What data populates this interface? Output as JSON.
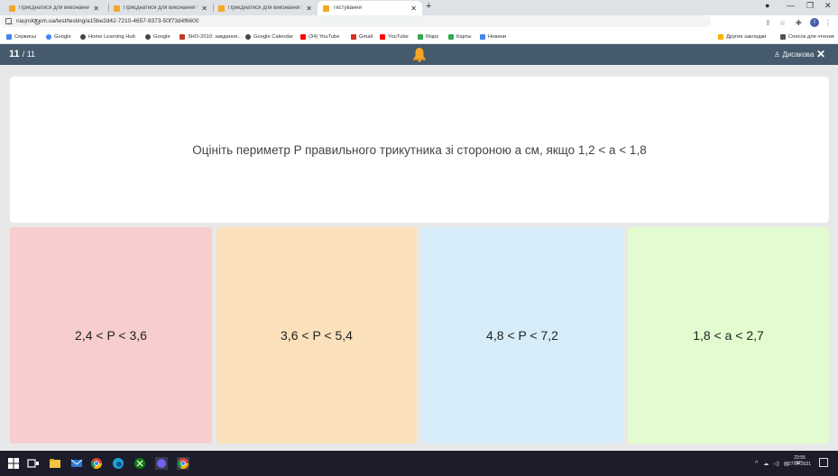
{
  "browser": {
    "tabs": [
      {
        "title": "Приєднатися для виконання те",
        "active": false
      },
      {
        "title": "Приєднатися для виконання те",
        "active": false
      },
      {
        "title": "Приєднатися для виконання те",
        "active": false
      },
      {
        "title": "Тестування",
        "active": true
      }
    ],
    "url": "naurok.com.ua/test/testing/a15be2d42-7210-4657-9373-50f73d4f6600",
    "bookmarks": [
      {
        "label": "Сервисы",
        "icon": "apps-grid-icon",
        "color": "#4285f4"
      },
      {
        "label": "Google",
        "icon": "google-icon",
        "color": "#4285f4"
      },
      {
        "label": "Home Learning Hub",
        "icon": "globe-icon",
        "color": "#444444"
      },
      {
        "label": "Google",
        "icon": "globe-icon",
        "color": "#444444"
      },
      {
        "label": "ЗНО-2010: завдання...",
        "icon": "zno-icon",
        "color": "#c0392b"
      },
      {
        "label": "Google Calendar",
        "icon": "globe-icon",
        "color": "#444444"
      },
      {
        "label": "(34) YouTube",
        "icon": "youtube-icon",
        "color": "#ff0000"
      },
      {
        "label": "Gmail",
        "icon": "gmail-icon",
        "color": "#d93025"
      },
      {
        "label": "YouTube",
        "icon": "youtube-icon",
        "color": "#ff0000"
      },
      {
        "label": "Maps",
        "icon": "maps-icon",
        "color": "#34a853"
      },
      {
        "label": "Карты",
        "icon": "maps-icon",
        "color": "#34a853"
      },
      {
        "label": "Новини",
        "icon": "news-icon",
        "color": "#4285f4"
      }
    ],
    "bookmarks_right": [
      {
        "label": "Другие закладки",
        "icon": "folder-icon",
        "color": "#f4b400"
      },
      {
        "label": "Список для чтения",
        "icon": "reading-list-icon",
        "color": "#555555"
      }
    ],
    "profile_initial": "I"
  },
  "quiz": {
    "current": "11",
    "total": "/ 11",
    "user_name": "Дисакова",
    "question": "Оцініть периметр P правильного трикутника зі стороною a см, якщо 1,2 < a < 1,8",
    "answers": [
      {
        "text": "2,4 < P < 3,6",
        "color": "#f7cdcd"
      },
      {
        "text": "3,6 < P < 5,4",
        "color": "#fbe1bb"
      },
      {
        "text": "4,8 < P < 7,2",
        "color": "#d6edf9"
      },
      {
        "text": "1,8 < a < 2,7",
        "color": "#e2fbcf"
      }
    ],
    "header_color": "#455a6c",
    "bell_color": "#f5a623"
  },
  "taskbar": {
    "language": "УКР",
    "time": "23:55",
    "date": "27.04.2021"
  }
}
